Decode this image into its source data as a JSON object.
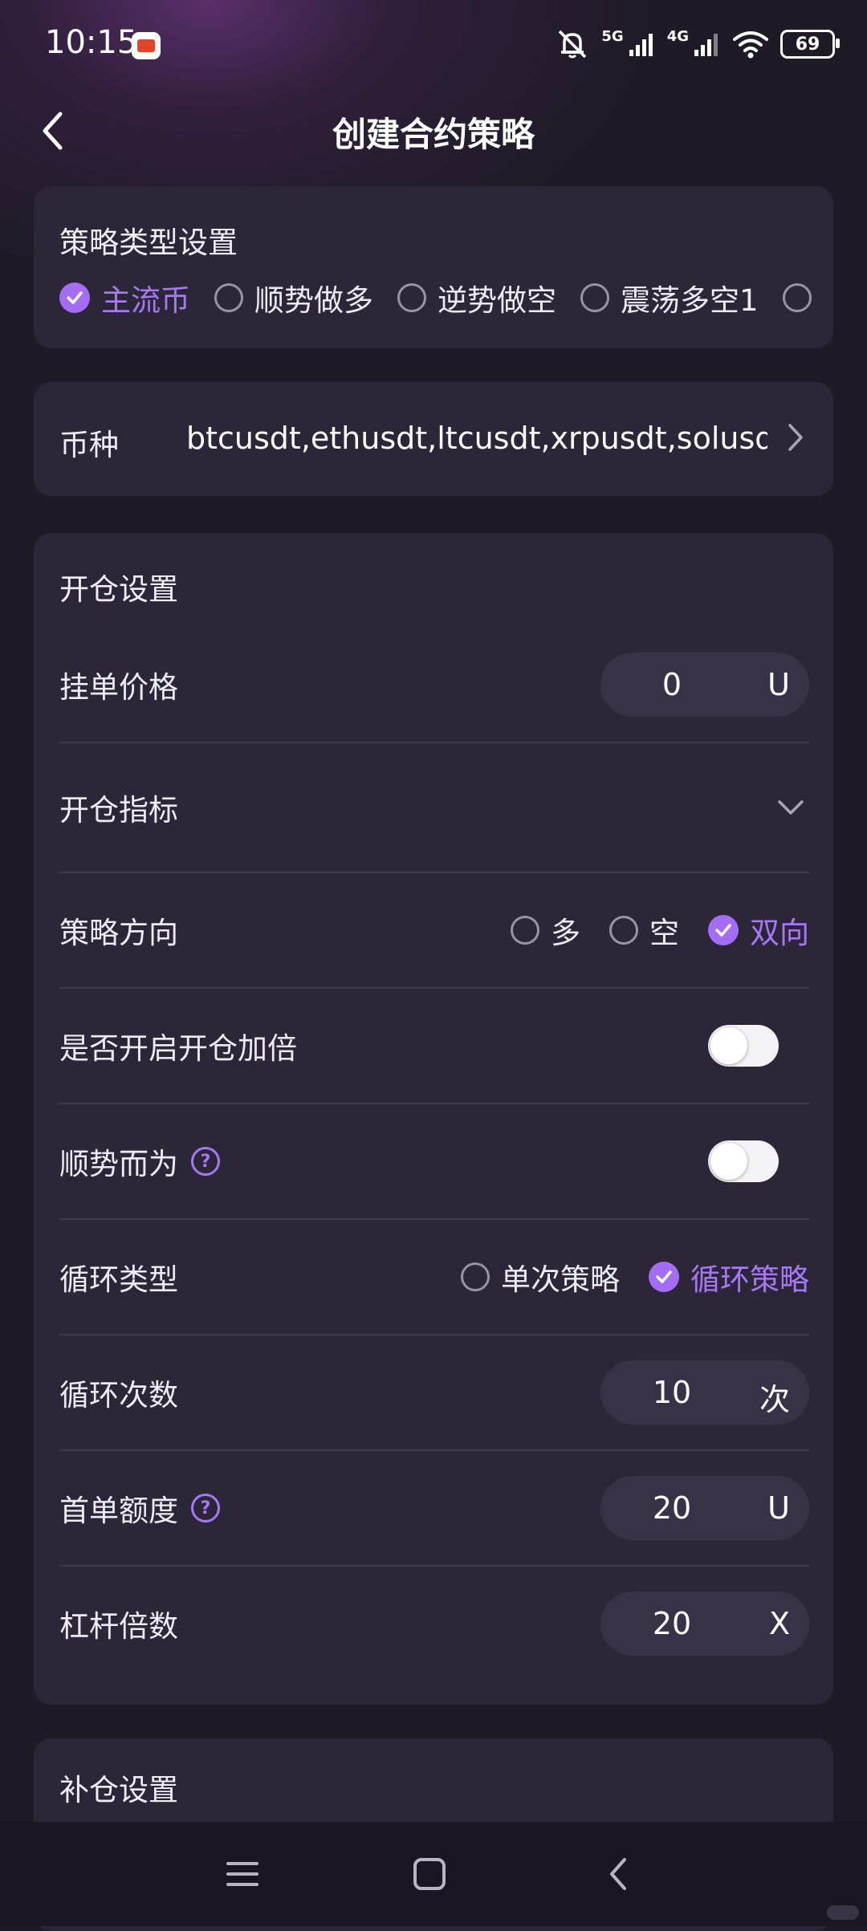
{
  "status_bar": {
    "time": "10:15",
    "net1": "5G",
    "net2": "4G",
    "battery": "69"
  },
  "header": {
    "title": "创建合约策略"
  },
  "strategy_type": {
    "title": "策略类型设置",
    "options": [
      {
        "label": "主流币",
        "checked": true
      },
      {
        "label": "顺势做多",
        "checked": false
      },
      {
        "label": "逆势做空",
        "checked": false
      },
      {
        "label": "震荡多空1",
        "checked": false
      }
    ]
  },
  "coin": {
    "label": "币种",
    "value": "btcusdt,ethusdt,ltcusdt,xrpusdt,solusdt"
  },
  "open_settings": {
    "title": "开仓设置",
    "order_price": {
      "label": "挂单价格",
      "value": "0",
      "unit": "U"
    },
    "indicator": {
      "label": "开仓指标"
    },
    "direction": {
      "label": "策略方向",
      "options": [
        {
          "label": "多",
          "checked": false
        },
        {
          "label": "空",
          "checked": false
        },
        {
          "label": "双向",
          "checked": true
        }
      ]
    },
    "double_open": {
      "label": "是否开启开仓加倍",
      "on": false
    },
    "follow_trend": {
      "label": "顺势而为",
      "on": false,
      "help": "?"
    },
    "loop_type": {
      "label": "循环类型",
      "options": [
        {
          "label": "单次策略",
          "checked": false
        },
        {
          "label": "循环策略",
          "checked": true
        }
      ]
    },
    "loop_count": {
      "label": "循环次数",
      "value": "10",
      "unit": "次"
    },
    "first_amount": {
      "label": "首单额度",
      "value": "20",
      "unit": "U",
      "help": "?"
    },
    "leverage": {
      "label": "杠杆倍数",
      "value": "20",
      "unit": "X"
    }
  },
  "add_settings": {
    "title": "补仓设置"
  },
  "colors": {
    "accent": "#a56cf6",
    "background": "#1e1b26",
    "card": "#2b2738"
  }
}
